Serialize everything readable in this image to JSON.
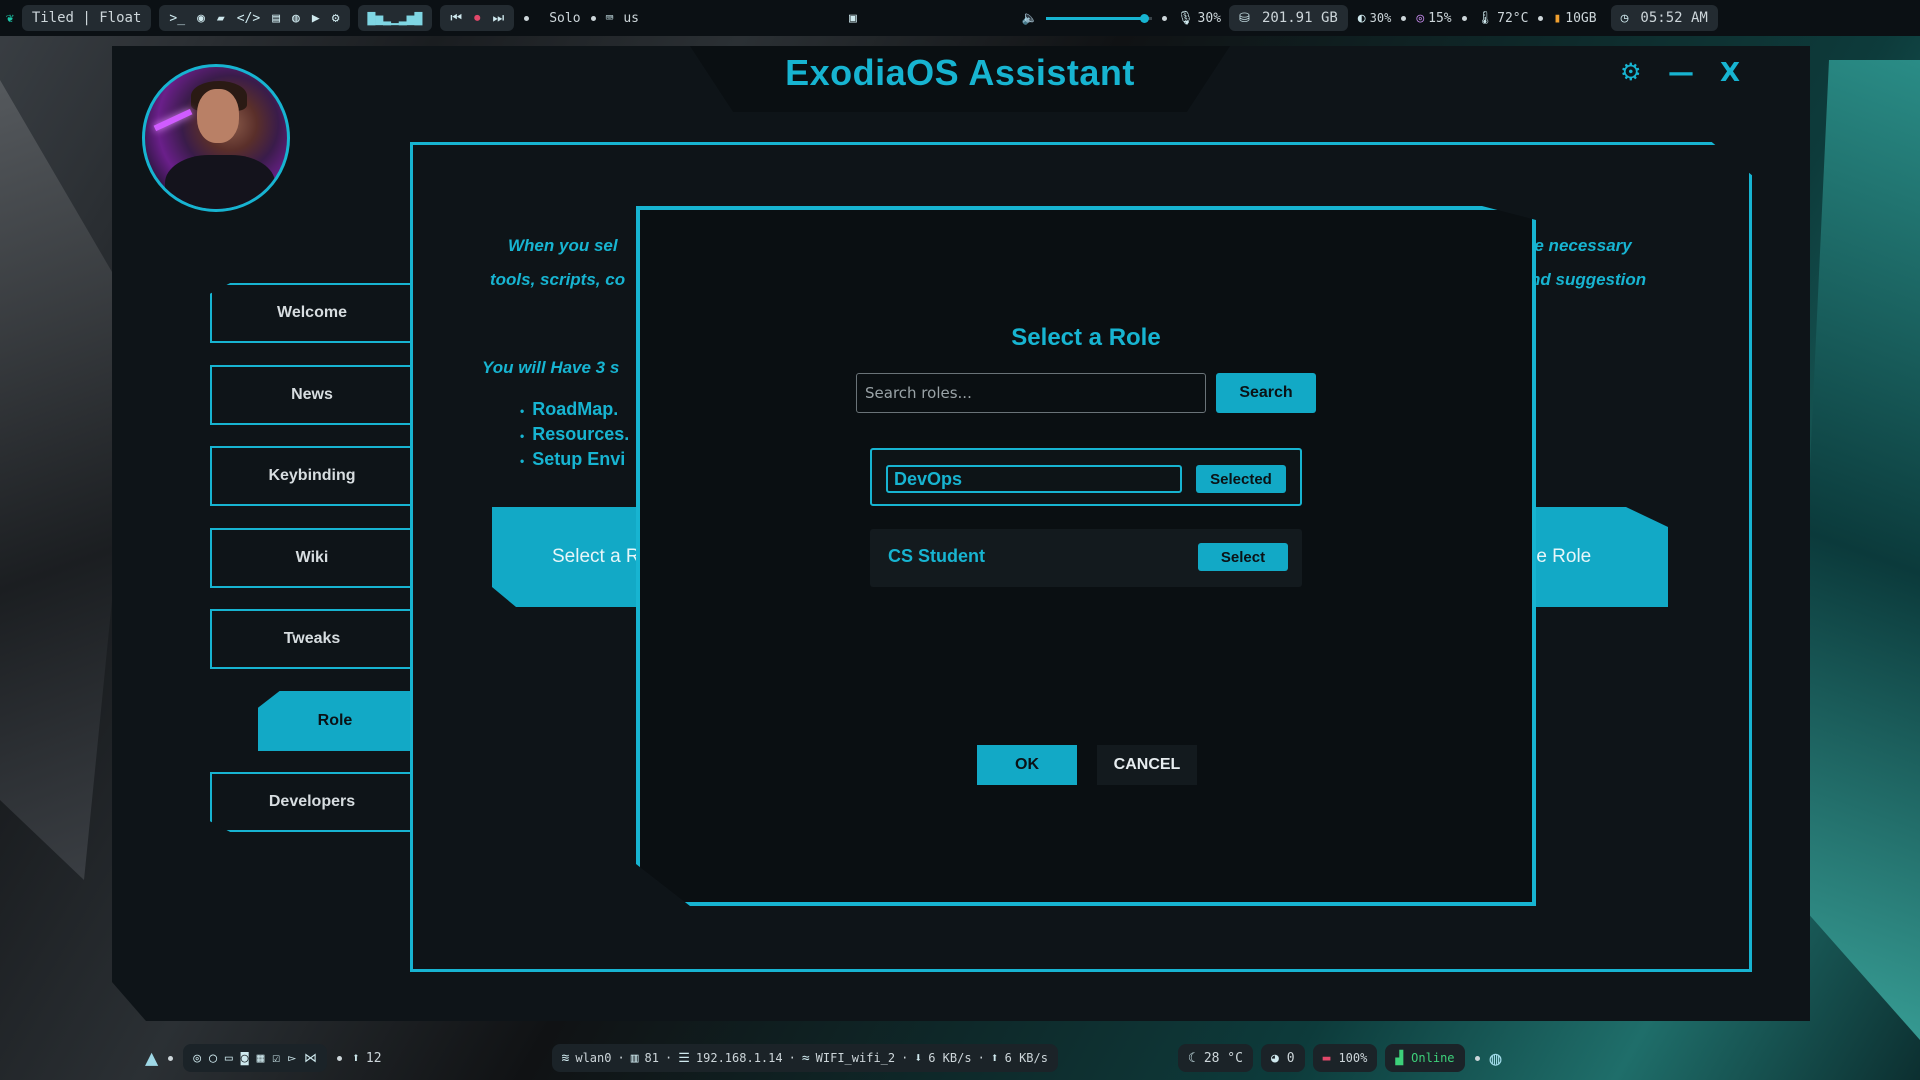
{
  "topbar": {
    "layout_label": "Tiled | Float",
    "workspace_label": "Solo",
    "keyboard_layout": "us",
    "volume": "30%",
    "mic_volume": "30%",
    "disk": "201.91 GB",
    "brightness": "30%",
    "cpu": "15%",
    "temp": "72°C",
    "memory": "10GB",
    "clock": "05:52 AM",
    "volume_level": 0.92
  },
  "window": {
    "title": "ExodiaOS Assistant",
    "settings_icon": "gear-icon",
    "minimize_label": "—",
    "close_label": "X"
  },
  "nav": {
    "items": [
      {
        "label": "Welcome"
      },
      {
        "label": "News"
      },
      {
        "label": "Keybinding"
      },
      {
        "label": "Wiki"
      },
      {
        "label": "Tweaks"
      },
      {
        "label": "Role"
      },
      {
        "label": "Developers"
      }
    ],
    "active": "Role"
  },
  "content": {
    "intro_line1_left": "When you sel",
    "intro_line1_right": "he necessary",
    "intro_line2_left": "tools, scripts, co",
    "intro_line2_right": "nd suggestion",
    "have_line": "You will Have 3 s",
    "bullets": [
      "RoadMap.",
      "Resources.",
      "Setup Envi"
    ],
    "left_button": "Select a R",
    "right_button": "re Role"
  },
  "modal": {
    "title": "Select a Role",
    "search_placeholder": "Search roles...",
    "search_button": "Search",
    "roles": [
      {
        "name": "DevOps",
        "button": "Selected",
        "selected": true
      },
      {
        "name": "CS Student",
        "button": "Select",
        "selected": false
      }
    ],
    "ok_label": "OK",
    "cancel_label": "CANCEL"
  },
  "bottombar": {
    "notifications_count": "12",
    "interface": "wlan0",
    "signal": "81",
    "ip": "192.168.1.14",
    "ssid": "WIFI_wifi_2",
    "down": "6 KB/s",
    "up": "6 KB/s",
    "weather": "28 °C",
    "github": "0",
    "battery": "100%",
    "status": "Online"
  },
  "colors": {
    "accent": "#17b4d1",
    "panel": "#0e1418"
  }
}
